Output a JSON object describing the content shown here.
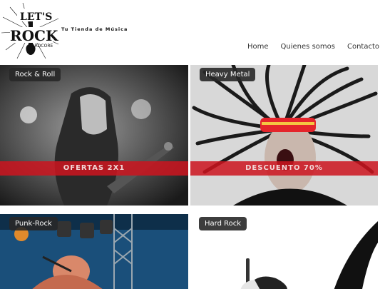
{
  "brand": {
    "logo_text_top": "LET'S",
    "logo_text_main": "ROCK",
    "logo_text_sub": "HARDCORE",
    "tagline": "Tu Tienda de Música"
  },
  "nav": {
    "items": [
      {
        "label": "Home"
      },
      {
        "label": "Quienes somos"
      },
      {
        "label": "Contacto"
      }
    ]
  },
  "cards": [
    {
      "badge": "Rock & Roll",
      "ribbon": "OFERTAS 2X1"
    },
    {
      "badge": "Heavy Metal",
      "ribbon": "DESCUENTO 70%"
    },
    {
      "badge": "Punk-Rock"
    },
    {
      "badge": "Hard Rock"
    }
  ],
  "colors": {
    "ribbon": "#cd141e",
    "badge_bg": "#282828"
  }
}
